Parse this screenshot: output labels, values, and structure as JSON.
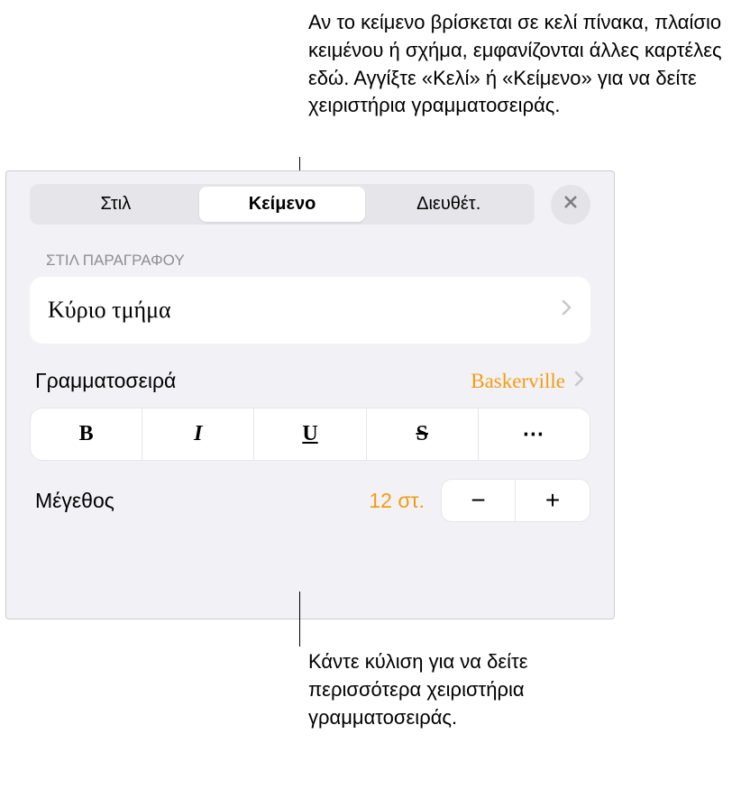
{
  "annotations": {
    "top": "Αν το κείμενο βρίσκεται σε κελί πίνακα, πλαίσιο κειμένου ή σχήμα, εμφανίζονται άλλες καρτέλες εδώ. Αγγίξτε «Κελί» ή «Κείμενο» για να δείτε χειριστήρια γραμματοσειράς.",
    "bottom": "Κάντε κύλιση για να δείτε περισσότερα χειριστήρια γραμματοσειράς."
  },
  "tabs": {
    "style": "Στιλ",
    "text": "Κείμενο",
    "arrange": "Διευθέτ."
  },
  "sections": {
    "paragraph_style": "ΣΤΙΛ ΠΑΡΑΓΡΑΦΟΥ"
  },
  "paragraph_style": {
    "value": "Κύριο τμήμα"
  },
  "font": {
    "label": "Γραμματοσειρά",
    "value": "Baskerville"
  },
  "style_buttons": {
    "bold": "B",
    "italic": "I",
    "underline": "U",
    "strikethrough": "S",
    "more": "⋯"
  },
  "size": {
    "label": "Μέγεθος",
    "value": "12 στ.",
    "minus": "−",
    "plus": "+"
  },
  "colors": {
    "accent": "#f39c12"
  }
}
